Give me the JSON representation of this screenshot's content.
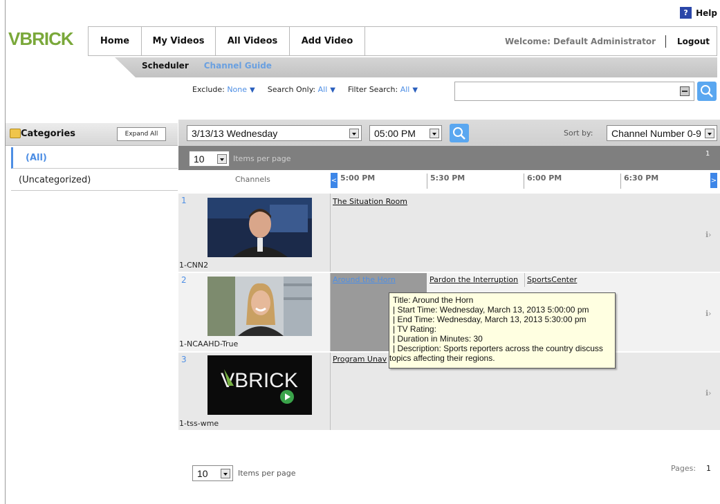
{
  "help": {
    "icon": "?",
    "label": "Help"
  },
  "logo": {
    "text": "VBRICK"
  },
  "nav": {
    "home": "Home",
    "my_videos": "My Videos",
    "all_videos": "All Videos",
    "add_video": "Add Video",
    "welcome": "Welcome: Default Administrator",
    "logout": "Logout"
  },
  "subnav": {
    "scheduler": "Scheduler",
    "channel_guide": "Channel Guide"
  },
  "filters": {
    "exclude_label": "Exclude:",
    "exclude_value": "None",
    "search_only_label": "Search Only:",
    "search_only_value": "All",
    "filter_search_label": "Filter Search:",
    "filter_search_value": "All",
    "search_value": ""
  },
  "categories": {
    "title": "Categories",
    "expand_all": "Expand All",
    "items": [
      "(All)",
      "(Uncategorized)"
    ]
  },
  "toolbar": {
    "date": "3/13/13 Wednesday",
    "time": "05:00 PM",
    "sort_by_label": "Sort by:",
    "sort_value": "Channel Number 0-9"
  },
  "paging": {
    "items_per_page": "10",
    "items_per_page_label": "Items per page",
    "page": "1",
    "pages_label": "Pages:",
    "pages_value": "1"
  },
  "guide": {
    "channels_header": "Channels",
    "times": [
      "5:00 PM",
      "5:30 PM",
      "6:00 PM",
      "6:30 PM"
    ],
    "channels": [
      {
        "number": "1",
        "name": "1-CNN2",
        "programs": [
          "The Situation Room"
        ]
      },
      {
        "number": "2",
        "name": "1-NCAAHD-True",
        "programs": [
          "Around the Horn",
          "Pardon the Interruption",
          "SportsCenter"
        ]
      },
      {
        "number": "3",
        "name": "1-tss-wme",
        "programs": [
          "Program Unav"
        ],
        "thumb_logo": "VBRICK"
      }
    ]
  },
  "tooltip": {
    "title": "Title: Around the Horn",
    "start": "| Start Time: Wednesday, March 13, 2013 5:00:00 pm",
    "end": "| End Time: Wednesday, March 13, 2013 5:30:00 pm",
    "rating": "| TV Rating:",
    "duration": "| Duration in Minutes: 30",
    "description": "| Description: Sports reporters across the country discuss",
    "description2": "topics affecting their regions."
  },
  "colors": {
    "accent": "#4d8ee4",
    "logo_green": "#7aa83a",
    "tooltip_bg": "#ffffe1"
  }
}
